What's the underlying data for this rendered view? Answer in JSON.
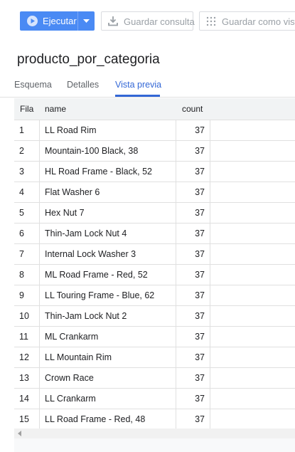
{
  "toolbar": {
    "run_label": "Ejecutar",
    "save_query_label": "Guardar consulta",
    "save_view_label": "Guardar como vista"
  },
  "title": "producto_por_categoria",
  "tabs": [
    {
      "label": "Esquema",
      "active": false
    },
    {
      "label": "Detalles",
      "active": false
    },
    {
      "label": "Vista previa",
      "active": true
    }
  ],
  "table": {
    "columns": [
      "Fila",
      "name",
      "count"
    ],
    "rows": [
      {
        "fila": "1",
        "name": "LL Road Rim",
        "count": "37"
      },
      {
        "fila": "2",
        "name": "Mountain-100 Black, 38",
        "count": "37"
      },
      {
        "fila": "3",
        "name": "HL Road Frame - Black, 52",
        "count": "37"
      },
      {
        "fila": "4",
        "name": "Flat Washer 6",
        "count": "37"
      },
      {
        "fila": "5",
        "name": "Hex Nut 7",
        "count": "37"
      },
      {
        "fila": "6",
        "name": "Thin-Jam Lock Nut 4",
        "count": "37"
      },
      {
        "fila": "7",
        "name": "Internal Lock Washer 3",
        "count": "37"
      },
      {
        "fila": "8",
        "name": "ML Road Frame - Red, 52",
        "count": "37"
      },
      {
        "fila": "9",
        "name": "LL Touring Frame - Blue, 62",
        "count": "37"
      },
      {
        "fila": "10",
        "name": "Thin-Jam Lock Nut 2",
        "count": "37"
      },
      {
        "fila": "11",
        "name": "ML Crankarm",
        "count": "37"
      },
      {
        "fila": "12",
        "name": "LL Mountain Rim",
        "count": "37"
      },
      {
        "fila": "13",
        "name": "Crown Race",
        "count": "37"
      },
      {
        "fila": "14",
        "name": "LL Crankarm",
        "count": "37"
      },
      {
        "fila": "15",
        "name": "LL Road Frame - Red, 48",
        "count": "37"
      }
    ]
  },
  "colors": {
    "primary": "#4a8af4",
    "tab_active": "#3367d6",
    "header_bg": "#f1f3f4"
  },
  "icons": [
    "play-icon",
    "chevron-down-icon",
    "download-icon",
    "grid-dots-icon",
    "scroll-left-icon"
  ]
}
